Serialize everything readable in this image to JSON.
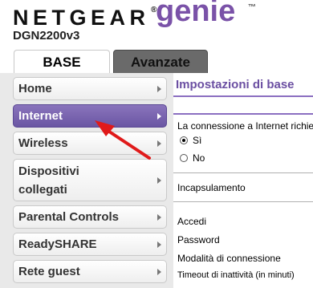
{
  "header": {
    "brand": "NETGEAR",
    "product": "genie",
    "model": "DGN2200v3"
  },
  "tabs": [
    {
      "label": "BASE"
    },
    {
      "label": "Avanzate"
    }
  ],
  "sidebar": {
    "items": [
      {
        "label": "Home"
      },
      {
        "label": "Internet"
      },
      {
        "label": "Wireless"
      },
      {
        "label_line1": "Dispositivi",
        "label_line2": "collegati"
      },
      {
        "label": "Parental Controls"
      },
      {
        "label": "ReadySHARE"
      },
      {
        "label": "Rete guest"
      }
    ]
  },
  "content": {
    "title": "Impostazioni di base",
    "question": "La connessione a Internet richiede un accesso?",
    "option_yes": "Sì",
    "option_no": "No",
    "selected_option": "Sì",
    "encapsulation_label": "Incapsulamento",
    "login_label": "Accedi",
    "password_label": "Password",
    "connection_mode_label": "Modalità di connessione",
    "idle_timeout_label": "Timeout di inattività (in minuti)"
  },
  "colors": {
    "accent": "#7a52a8",
    "active_nav": "#6f5aa8",
    "annotation": "#e01a1a"
  }
}
